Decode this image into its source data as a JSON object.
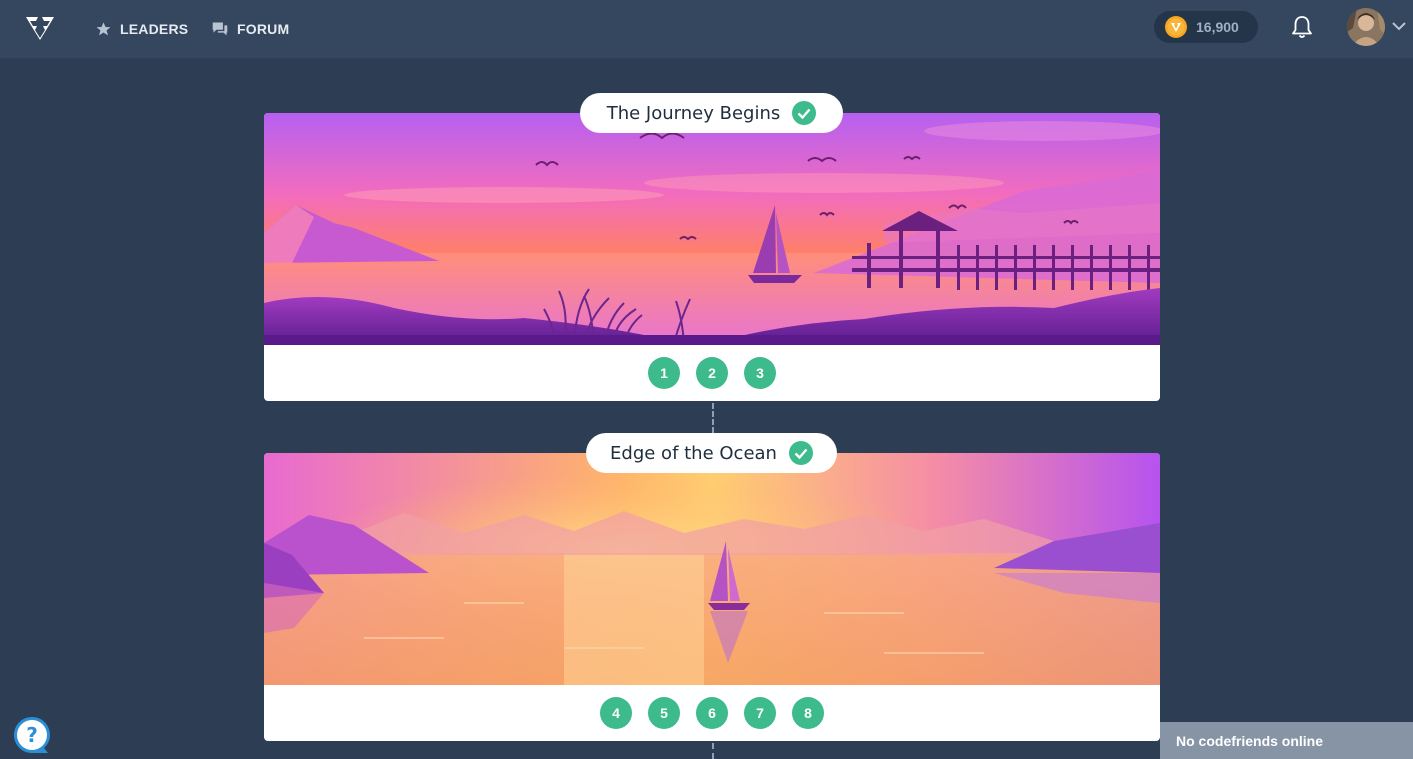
{
  "nav": {
    "logo_icon": "codefights-logo-icon",
    "leaders_label": "LEADERS",
    "forum_label": "FORUM",
    "coins": "16,900",
    "bell_icon": "bell-icon",
    "avatar_icon": "user-avatar"
  },
  "chapters": [
    {
      "title": "The Journey Begins",
      "completed": true,
      "scene": "sunset-lake-pier",
      "steps": [
        "1",
        "2",
        "3"
      ]
    },
    {
      "title": "Edge of the Ocean",
      "completed": true,
      "scene": "ocean-sunrise-sailboat",
      "steps": [
        "4",
        "5",
        "6",
        "7",
        "8"
      ]
    }
  ],
  "footer": {
    "help_icon": "help-icon",
    "friends_status": "No codefriends online"
  },
  "colors": {
    "background": "#2c3d54",
    "topbar": "#34475f",
    "step_green": "#3dbb8c",
    "card": "#ffffff"
  }
}
